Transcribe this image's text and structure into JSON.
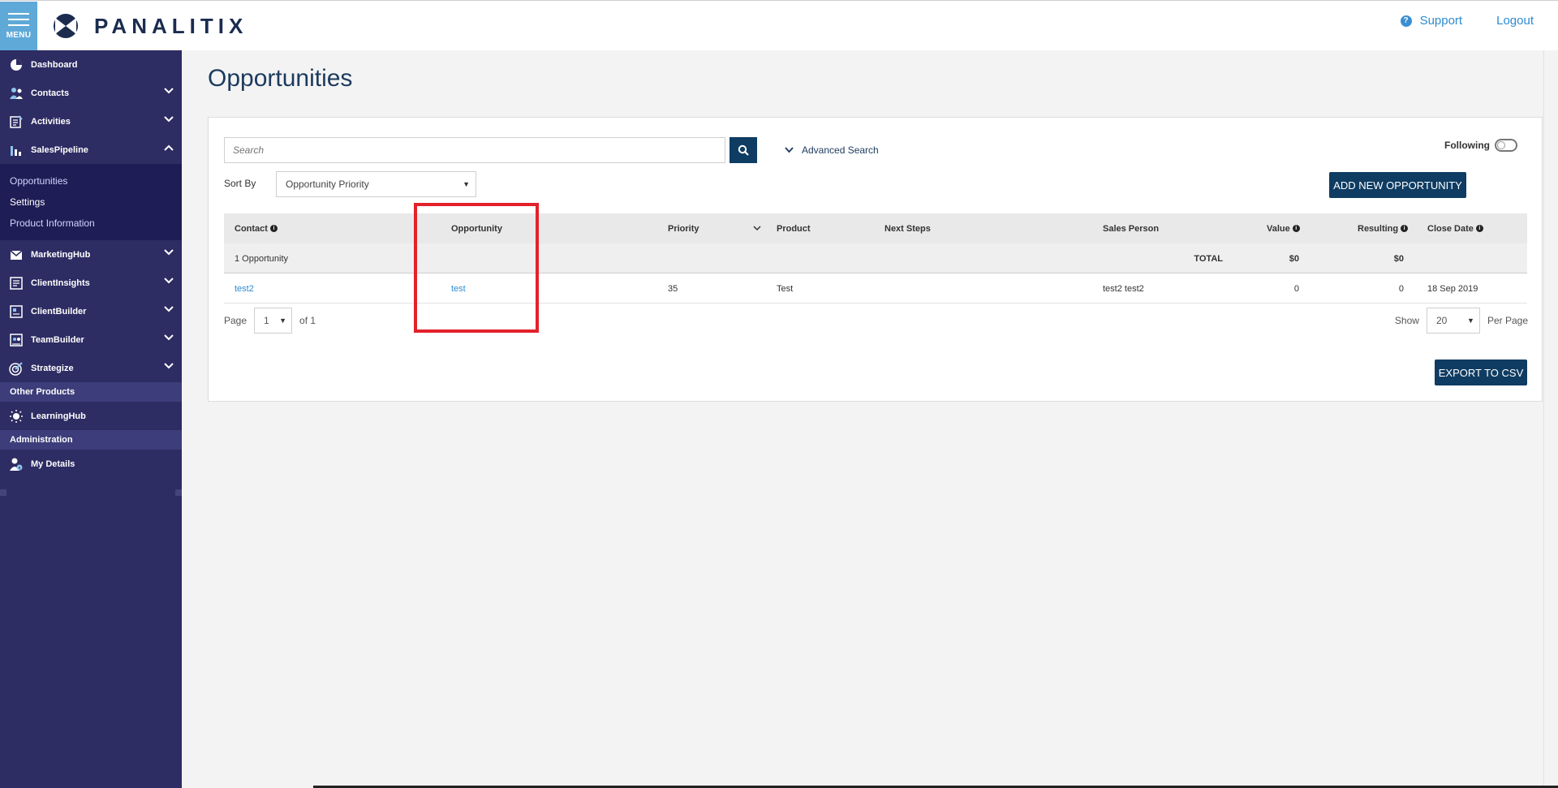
{
  "header": {
    "menu_label": "MENU",
    "logo_text": "PANALITIX",
    "support": "Support",
    "logout": "Logout"
  },
  "sidebar": {
    "items": [
      {
        "label": "Dashboard",
        "icon": "pie-chart-icon"
      },
      {
        "label": "Contacts",
        "icon": "contacts-icon"
      },
      {
        "label": "Activities",
        "icon": "activities-icon"
      },
      {
        "label": "SalesPipeline",
        "icon": "bar-chart-icon"
      }
    ],
    "sales_sub": [
      "Opportunities",
      "Settings",
      "Product Information"
    ],
    "items2": [
      {
        "label": "MarketingHub",
        "icon": "marketing-icon"
      },
      {
        "label": "ClientInsights",
        "icon": "insights-icon"
      },
      {
        "label": "ClientBuilder",
        "icon": "builder-icon"
      },
      {
        "label": "TeamBuilder",
        "icon": "team-icon"
      },
      {
        "label": "Strategize",
        "icon": "target-icon"
      }
    ],
    "other_products": "Other Products",
    "learning": "LearningHub",
    "administration": "Administration",
    "my_details": "My Details"
  },
  "main": {
    "title": "Opportunities",
    "search_placeholder": "Search",
    "advanced_search": "Advanced Search",
    "following": "Following",
    "sort_by": "Sort By",
    "sort_value": "Opportunity Priority",
    "add_button": "ADD NEW OPPORTUNITY",
    "columns": [
      "Contact",
      "Opportunity",
      "Priority",
      "Product",
      "Next Steps",
      "Sales Person",
      "Value",
      "Resulting",
      "Close Date"
    ],
    "summary": {
      "count": "1 Opportunity",
      "total_label": "TOTAL",
      "value_total": "$0",
      "resulting_total": "$0"
    },
    "rows": [
      {
        "contact": "test2",
        "opportunity": "test",
        "priority": "35",
        "product": "Test",
        "next_steps": "",
        "sales_person": "test2 test2",
        "value": "0",
        "resulting": "0",
        "close_date": "18 Sep 2019"
      }
    ],
    "pager": {
      "page_label": "Page",
      "page_value": "1",
      "of_label": "of 1",
      "show_label": "Show",
      "per_page_value": "20",
      "per_page_label": "Per Page"
    },
    "export_button": "EXPORT TO CSV"
  }
}
